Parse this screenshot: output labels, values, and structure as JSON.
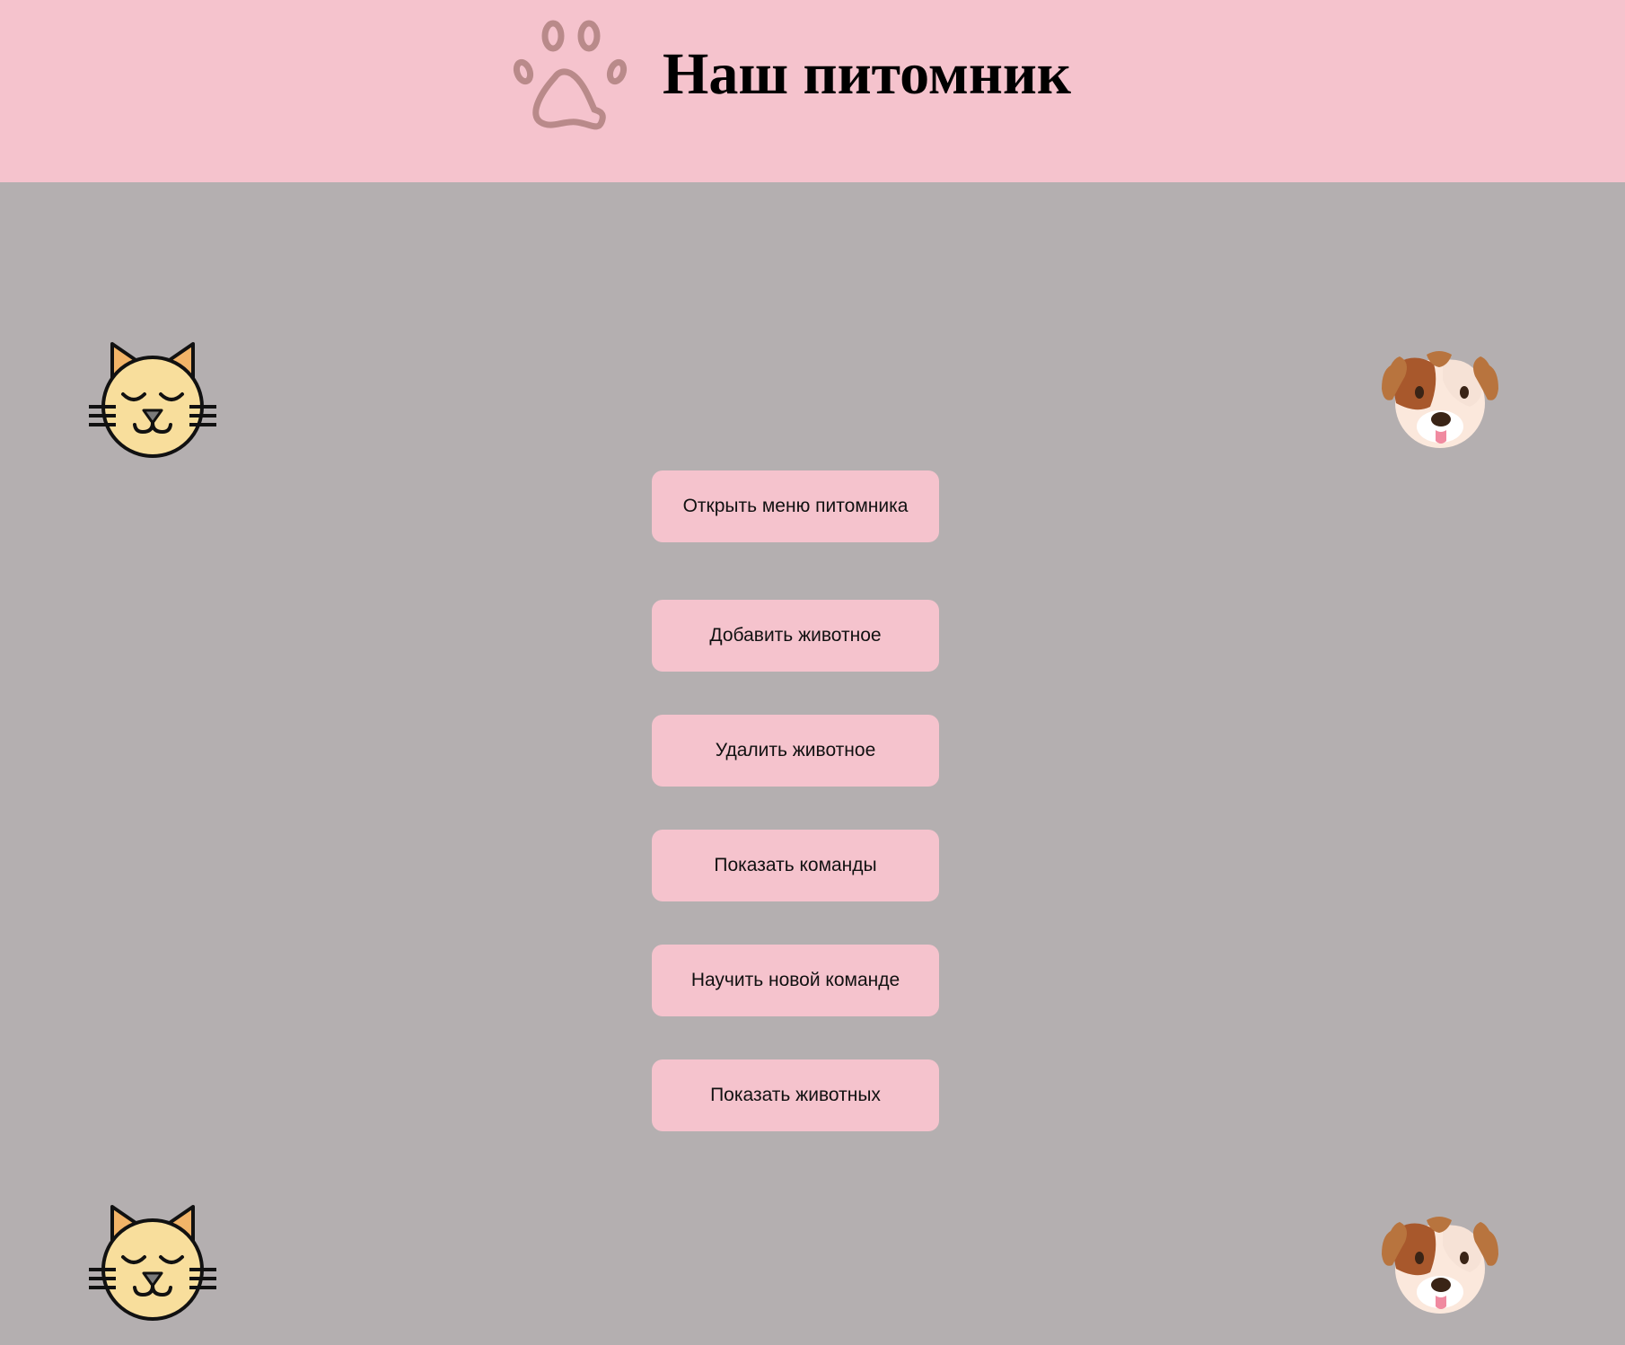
{
  "header": {
    "title": "Наш питомник",
    "logo_icon": "paw-icon"
  },
  "decorations": {
    "left_icon": "cat-face-icon",
    "right_icon": "dog-face-icon"
  },
  "menu": {
    "buttons": [
      {
        "label": "Открыть меню питомника"
      },
      {
        "label": "Добавить животное"
      },
      {
        "label": "Удалить животное"
      },
      {
        "label": "Показать команды"
      },
      {
        "label": "Научить новой команде"
      },
      {
        "label": "Показать животных"
      }
    ]
  },
  "colors": {
    "header_bg": "#f5c3cd",
    "page_bg": "#b4afb0",
    "button_bg": "#f5c3cd",
    "paw": "#b98a8a"
  }
}
